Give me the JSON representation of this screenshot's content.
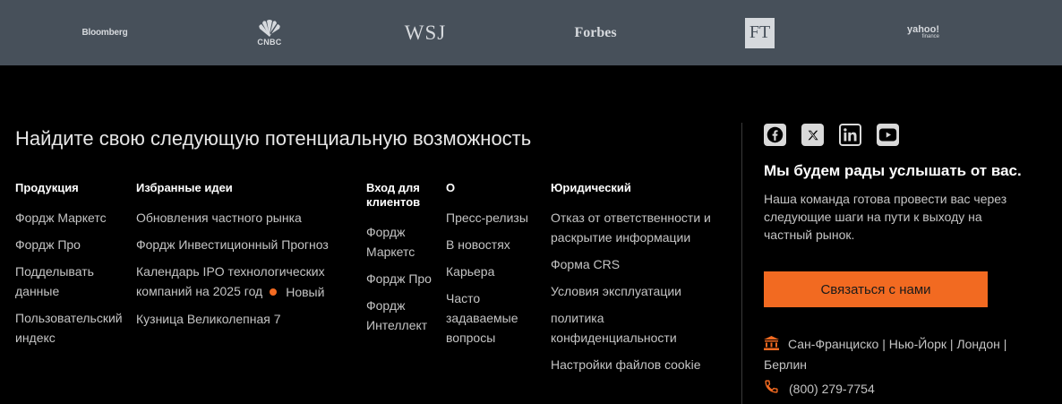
{
  "press_logos": [
    {
      "name": "bloomberg",
      "text": "Bloomberg"
    },
    {
      "name": "cnbc",
      "text": "CNBC"
    },
    {
      "name": "wsj",
      "text": "WSJ"
    },
    {
      "name": "forbes",
      "text": "Forbes"
    },
    {
      "name": "ft",
      "text": "FT"
    },
    {
      "name": "yahoo",
      "text": "yahoo!",
      "sub": "finance"
    }
  ],
  "headline": "Найдите свою следующую потенциальную возможность",
  "columns": {
    "products": {
      "title": "Продукция",
      "links": [
        "Фордж Маркетс",
        "Фордж Про",
        "Подделывать данные",
        "Пользовательский индекс"
      ]
    },
    "ideas": {
      "title": "Избранные идеи",
      "links": [
        "Обновления частного рынка",
        "Фордж Инвестиционный Прогноз",
        "Календарь IPO технологических компаний на 2025 год",
        "Кузница Великолепная 7"
      ],
      "badge": "Новый"
    },
    "login": {
      "title": "Вход для клиентов",
      "links": [
        "Фордж Маркетс",
        "Фордж Про",
        "Фордж Интеллект"
      ]
    },
    "about": {
      "title": "О",
      "links": [
        "Пресс-релизы",
        "В новостях",
        "Карьера",
        "Часто задаваемые вопросы"
      ]
    },
    "legal": {
      "title": "Юридический",
      "links": [
        "Отказ от ответственности и раскрытие информации",
        "Форма CRS",
        "Условия эксплуатации",
        "политика конфиденциальности",
        "Настройки файлов cookie"
      ]
    }
  },
  "socials": [
    {
      "name": "facebook-icon",
      "label": "facebook"
    },
    {
      "name": "x-icon",
      "label": "x"
    },
    {
      "name": "linkedin-icon",
      "label": "linkedin"
    },
    {
      "name": "youtube-icon",
      "label": "youtube"
    }
  ],
  "contact": {
    "title": "Мы будем рады услышать от вас.",
    "description": "Наша команда готова провести вас через следующие шаги на пути к выходу на частный рынок.",
    "button_label": "Связаться с нами",
    "address": "Сан-Франциско | Нью-Йорк | Лондон | Берлин",
    "phone": "(800) 279-7754"
  },
  "colors": {
    "accent": "#f26a21",
    "press_bar": "#47505a",
    "background": "#000000"
  }
}
